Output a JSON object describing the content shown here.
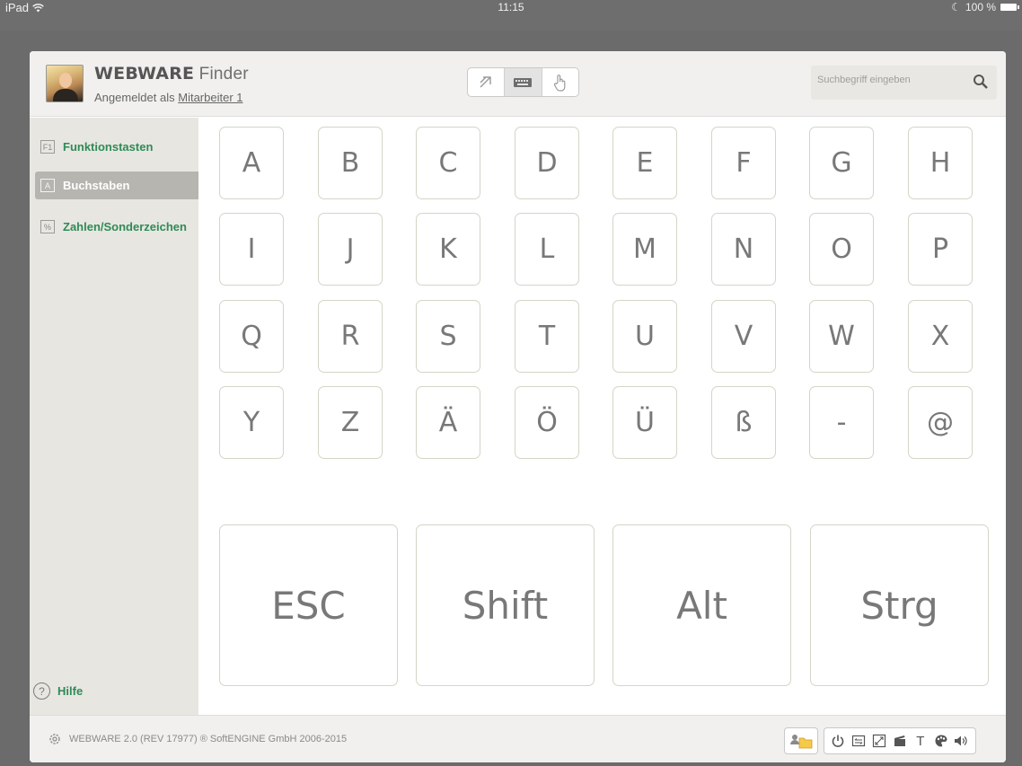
{
  "statusbar": {
    "device": "iPad",
    "time": "11:15",
    "battery": "100 %"
  },
  "header": {
    "brand_bold": "WEBWARE",
    "brand_light": " Finder",
    "login_prefix": "Angemeldet als ",
    "login_user": "Mitarbeiter 1",
    "search_placeholder": "Suchbegriff eingeben"
  },
  "sidebar": {
    "items": [
      {
        "icon": "F1",
        "label": "Funktionstasten"
      },
      {
        "icon": "A",
        "label": "Buchstaben"
      },
      {
        "icon": "%",
        "label": "Zahlen/Sonderzeichen"
      }
    ],
    "help_label": "Hilfe",
    "help_icon": "?"
  },
  "keys": {
    "rows": [
      [
        "A",
        "B",
        "C",
        "D",
        "E",
        "F",
        "G",
        "H"
      ],
      [
        "I",
        "J",
        "K",
        "L",
        "M",
        "N",
        "O",
        "P"
      ],
      [
        "Q",
        "R",
        "S",
        "T",
        "U",
        "V",
        "W",
        "X"
      ],
      [
        "Y",
        "Z",
        "Ä",
        "Ö",
        "Ü",
        "ß",
        "-",
        "@"
      ]
    ],
    "modifiers": [
      "ESC",
      "Shift",
      "Alt",
      "Strg"
    ]
  },
  "footer": {
    "copyright": "WEBWARE 2.0 (REV 17977) ® SoftENGINE GmbH 2006-2015",
    "text_tool_label": "T"
  },
  "colors": {
    "accent_green": "#2e8b57",
    "sidebar_bg": "#e8e6e1",
    "header_bg": "#f1f0ee",
    "key_border": "#d3d6c6",
    "active_nav_bg": "#b7b5b0"
  }
}
